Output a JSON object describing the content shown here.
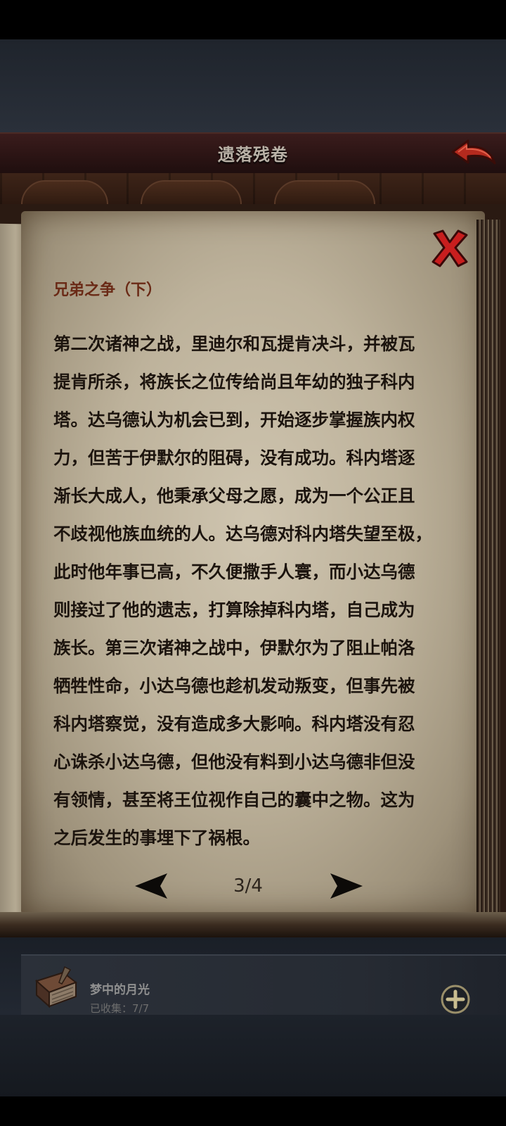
{
  "header": {
    "title": "遗落残卷"
  },
  "document": {
    "title": "兄弟之争（下）",
    "body": "第二次诸神之战，里迪尔和瓦提肯决斗，并被瓦\n提肯所杀，将族长之位传给尚且年幼的独子科内\n塔。达乌德认为机会已到，开始逐步掌握族内权\n力，但苦于伊默尔的阻碍，没有成功。科内塔逐\n渐长大成人，他秉承父母之愿，成为一个公正且\n不歧视他族血统的人。达乌德对科内塔失望至极，\n此时他年事已高，不久便撒手人寰，而小达乌德\n则接过了他的遗志，打算除掉科内塔，自己成为\n族长。第三次诸神之战中，伊默尔为了阻止帕洛\n牺牲性命，小达乌德也趁机发动叛变，但事先被\n科内塔察觉，没有造成多大影响。科内塔没有忍\n心诛杀小达乌德，但他没有料到小达乌德非但没\n有领情，甚至将王位视作自己的囊中之物。这为\n之后发生的事埋下了祸根。"
  },
  "pagination": {
    "indicator": "3/4"
  },
  "collection": {
    "title": "梦中的月光",
    "count": "已收集：7/7"
  },
  "icons": {
    "back": "back-arrow-icon",
    "close": "close-x-icon",
    "prev": "left-triangle-icon",
    "next": "right-triangle-icon",
    "add": "plus-circle-icon",
    "book": "book-icon"
  },
  "colors": {
    "close_red": "#c81e1e",
    "title_brown": "#6a2a16",
    "parchment": "#bdb29b"
  }
}
